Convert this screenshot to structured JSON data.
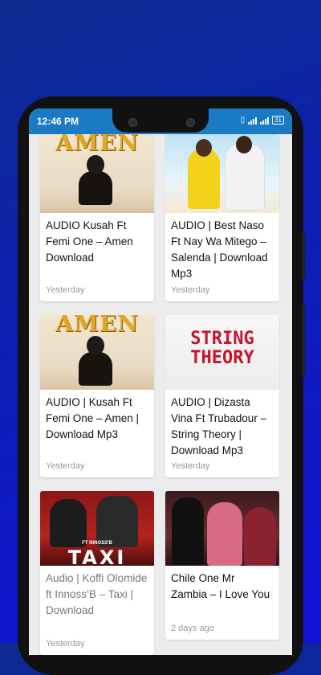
{
  "status_bar": {
    "time": "12:46 PM",
    "battery": "31"
  },
  "thumb_text": {
    "amen": "AMEN",
    "string_theory": "STRING THEORY",
    "taxi": "TAXI",
    "taxi_feat": "FT INNOSS'B"
  },
  "posts": [
    {
      "title": "AUDIO Kusah Ft Femi One – Amen Download",
      "date": "Yesterday",
      "thumb": "amen"
    },
    {
      "title": "AUDIO | Best Naso Ft Nay Wa Mitego – Salenda | Download Mp3",
      "date": "Yesterday",
      "thumb": "naso"
    },
    {
      "title": "AUDIO | Kusah Ft Femi One – Amen | Download Mp3",
      "date": "Yesterday",
      "thumb": "amen"
    },
    {
      "title": "AUDIO | Dizasta Vina Ft Trubadour – String Theory | Download Mp3",
      "date": "Yesterday",
      "thumb": "string"
    },
    {
      "title": "Audio | Koffi Olomide ft Innoss’B – Taxi | Download",
      "date": "Yesterday",
      "thumb": "taxi"
    },
    {
      "title": "Chile One Mr Zambia – I Love You",
      "date": "2 days ago",
      "thumb": "chile"
    }
  ],
  "colors": {
    "status_bar": "#1a7bc4",
    "background": "#0b1fb3",
    "date_text": "#999999"
  }
}
